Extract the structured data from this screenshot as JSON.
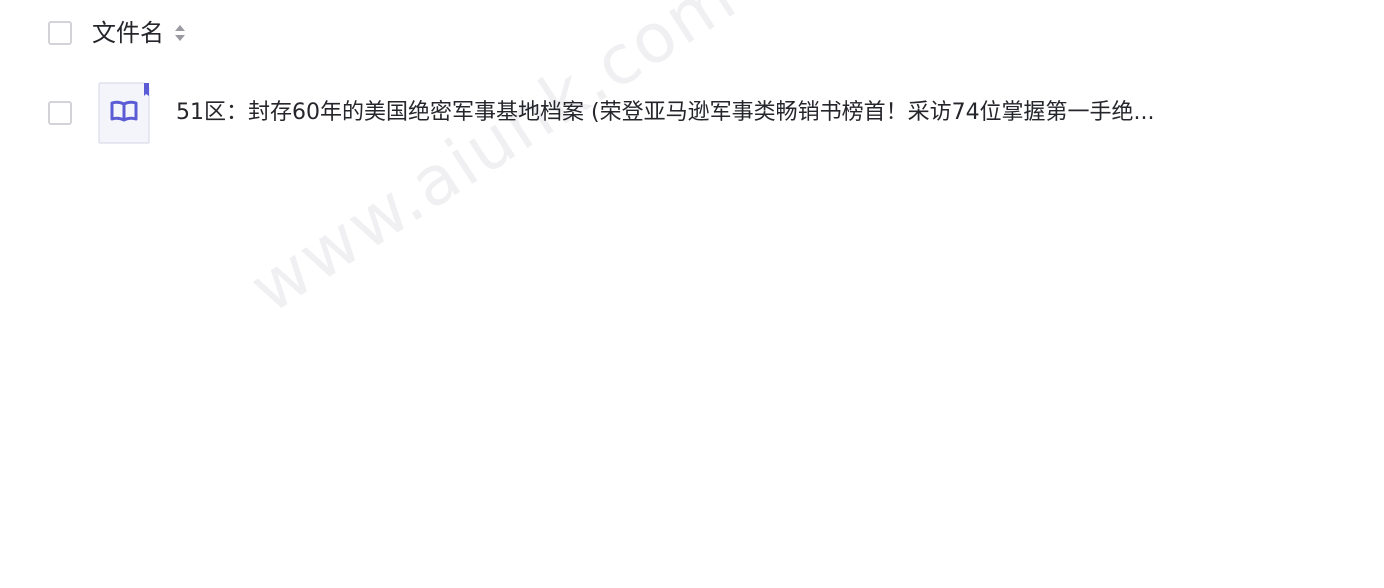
{
  "header": {
    "column_label": "文件名",
    "sort_icon": "sort-updown-icon"
  },
  "files": [
    {
      "name": "51区：封存60年的美国绝密军事基地档案 (荣登亚马逊军事类畅销书榜首！采访74位掌握第一手绝...",
      "icon": "book-file-icon"
    }
  ],
  "watermark": "www.aiunk.com",
  "colors": {
    "text": "#25262b",
    "checkbox_border": "#d4d4d8",
    "icon_accent": "#5b5bd6",
    "icon_bg": "#f4f4fb"
  }
}
